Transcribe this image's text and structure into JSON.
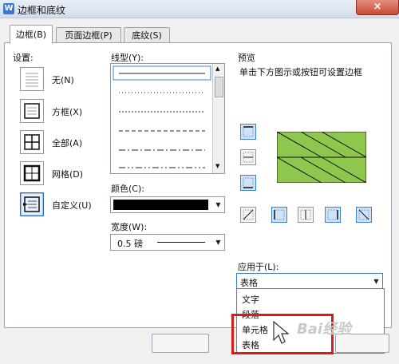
{
  "window": {
    "title": "边框和底纹",
    "close_label": "×",
    "app_icon_label": "W"
  },
  "tabs": [
    {
      "label": "边框(B)",
      "active": true
    },
    {
      "label": "页面边框(P)",
      "active": false
    },
    {
      "label": "底纹(S)",
      "active": false
    }
  ],
  "settings": {
    "heading": "设置:",
    "items": [
      {
        "label": "无(N)",
        "icon": "border-none-icon"
      },
      {
        "label": "方框(X)",
        "icon": "border-box-icon"
      },
      {
        "label": "全部(A)",
        "icon": "border-all-icon"
      },
      {
        "label": "网格(D)",
        "icon": "border-grid-icon"
      },
      {
        "label": "自定义(U)",
        "icon": "border-custom-icon",
        "selected": true
      }
    ]
  },
  "line_style": {
    "label": "线型(Y):"
  },
  "color": {
    "label": "颜色(C):",
    "value": "#000000"
  },
  "width": {
    "label": "宽度(W):",
    "value": "0.5 磅"
  },
  "preview": {
    "heading": "预览",
    "hint": "单击下方图示或按钮可设置边框",
    "fill_color": "#8ec64e"
  },
  "apply_to": {
    "label": "应用于(L):",
    "value": "表格",
    "options": [
      "文字",
      "段落",
      "单元格",
      "表格"
    ],
    "highlighted": "单元格"
  },
  "watermark": "Bai经验"
}
